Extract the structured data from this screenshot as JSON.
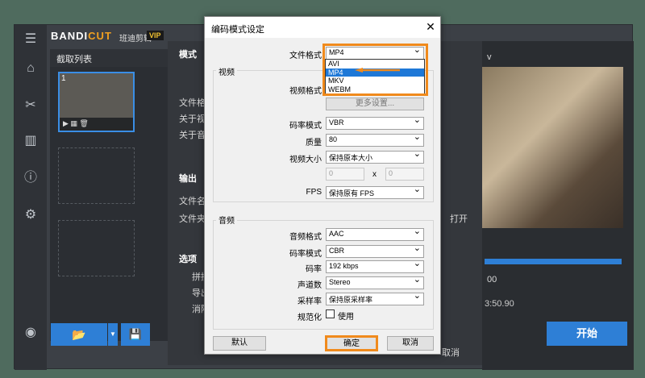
{
  "app": {
    "logo_main": "BANDI",
    "logo_cut": "CUT",
    "logo_sub": "班迪剪辑",
    "vip": "VIP"
  },
  "clip_list": {
    "header": "截取列表",
    "clip_number": "1",
    "thumb_controls": "▶ ▦ 🗑"
  },
  "main_panel": {
    "mode_label": "模式",
    "file_format_label": "文件格式",
    "about_video_label": "关于视频",
    "about_audio_label": "关于音频",
    "output_title": "输出",
    "filename_label": "文件名",
    "folder_label": "文件夹",
    "open_label": "打开",
    "options_title": "选项",
    "opt1": "拼接",
    "opt2": "导出",
    "opt3": "消除",
    "cancel_label": "取消"
  },
  "preview": {
    "name_fragment": "v",
    "timecode": "3:50.90",
    "time_fragment": "00",
    "start_button": "开始"
  },
  "dialog": {
    "title": "编码模式设定",
    "close": "✕",
    "file_format_label": "文件格式",
    "file_format_value": "MP4",
    "file_format_options": [
      "AVI",
      "MP4",
      "MKV",
      "WEBM"
    ],
    "selected_option_index": 1,
    "video_group": "视频",
    "video_format_label": "视频格式",
    "more_settings": "更多设置...",
    "bitrate_mode_label": "码率模式",
    "bitrate_mode_value": "VBR",
    "quality_label": "质量",
    "quality_value": "80",
    "video_size_label": "视频大小",
    "video_size_value": "保持原本大小",
    "width_value": "0",
    "size_sep": "x",
    "height_value": "0",
    "fps_label": "FPS",
    "fps_value": "保持原有 FPS",
    "audio_group": "音频",
    "audio_format_label": "音频格式",
    "audio_format_value": "AAC",
    "audio_bitrate_mode_label": "码率模式",
    "audio_bitrate_mode_value": "CBR",
    "audio_bitrate_label": "码率",
    "audio_bitrate_value": "192 kbps",
    "channels_label": "声道数",
    "channels_value": "Stereo",
    "samplerate_label": "采样率",
    "samplerate_value": "保持原采样率",
    "normalize_label": "规范化",
    "normalize_checkbox_label": "使用",
    "default_button": "默认",
    "ok_button": "确定",
    "cancel_button": "取消"
  },
  "colors": {
    "accent": "#2e7fd6",
    "highlight": "#f08a1c"
  }
}
